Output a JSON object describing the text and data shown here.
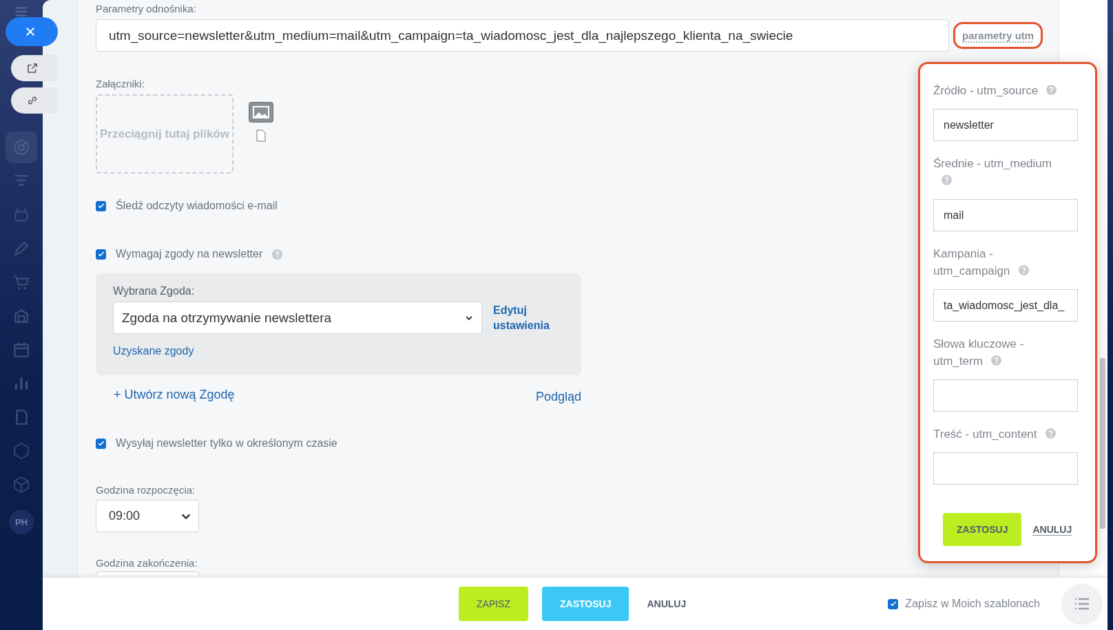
{
  "sidebar": {
    "avatar_initials": "PH"
  },
  "link_params": {
    "label": "Parametry odnośnika:",
    "value": "utm_source=newsletter&utm_medium=mail&utm_campaign=ta_wiadomosc_jest_dla_najlepszego_klienta_na_swiecie",
    "utm_button": "parametry utm"
  },
  "attachments": {
    "label": "Załączniki:",
    "dropzone": "Przeciągnij tutaj plików"
  },
  "options": [
    {
      "label": "Śledź odczyty wiadomości e-mail",
      "checked": true,
      "help": false
    },
    {
      "label": "Wymagaj zgody na newsletter",
      "checked": true,
      "help": true
    }
  ],
  "consent": {
    "label": "Wybrana Zgoda:",
    "value": "Zgoda na otrzymywanie newslettera",
    "edit_link": "Edytuj ustawienia",
    "obtained_link": "Uzyskane zgody",
    "create_link": "+ Utwórz nową Zgodę",
    "preview_link": "Podgląd"
  },
  "schedule": {
    "label": "Wysyłaj newsletter tylko w określonym czasie",
    "checked": true,
    "start_label": "Godzina rozpoczęcia:",
    "start_value": "09:00",
    "end_label": "Godzina zakończenia:"
  },
  "utm_popup": {
    "fields": [
      {
        "label": "Źródło - utm_source",
        "value": "newsletter",
        "help": true
      },
      {
        "label": "Średnie - utm_medium",
        "value": "mail",
        "help": true
      },
      {
        "label": "Kampania - utm_campaign",
        "value": "ta_wiadomosc_jest_dla_",
        "help": true
      },
      {
        "label": "Słowa kluczowe - utm_term",
        "help": true
      },
      {
        "label": "Treść - utm_content",
        "help": true
      }
    ],
    "apply": "ZASTOSUJ",
    "cancel": "ANULUJ"
  },
  "footer": {
    "save": "ZAPISZ",
    "apply": "ZASTOSUJ",
    "cancel": "ANULUJ",
    "template_label": "Zapisz w Moich szablonach",
    "template_checked": true
  }
}
